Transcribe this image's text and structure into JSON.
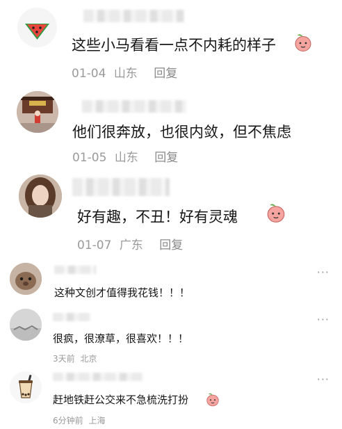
{
  "comments": [
    {
      "text": "这些小马看看一点不内耗的样子",
      "date": "01-04",
      "location": "山东",
      "reply_label": "回复",
      "avatar_icon": "watermelon-icon",
      "emoji": "peach-emoji-icon"
    },
    {
      "text": "他们很奔放，也很内敛，但不焦虑",
      "date": "01-05",
      "location": "山东",
      "reply_label": "回复",
      "avatar_icon": "temple-photo"
    },
    {
      "text": "好有趣，不丑！好有灵魂",
      "date": "01-07",
      "location": "广东",
      "reply_label": "回复",
      "avatar_icon": "woman-photo",
      "emoji": "peach-emoji-icon"
    },
    {
      "text": "这种文创才值得我花钱！！！",
      "more_label": "···",
      "avatar_icon": "animal-photo"
    },
    {
      "text": "很疯，很潦草，很喜欢！！！",
      "time": "3天前",
      "location": "北京",
      "more_label": "···",
      "avatar_icon": "landscape-photo"
    },
    {
      "text": "赶地铁赶公交来不急梳洗打扮",
      "time": "6分钟前",
      "location": "上海",
      "more_label": "···",
      "avatar_icon": "bubble-tea-icon",
      "emoji": "peach-emoji-icon"
    }
  ],
  "colors": {
    "text": "#161616",
    "meta": "#9a9a9a",
    "divider": "#eeeeee",
    "watermelon_red": "#e8453c",
    "watermelon_green": "#2f9e44",
    "peach_pink": "#f6a4a0"
  }
}
